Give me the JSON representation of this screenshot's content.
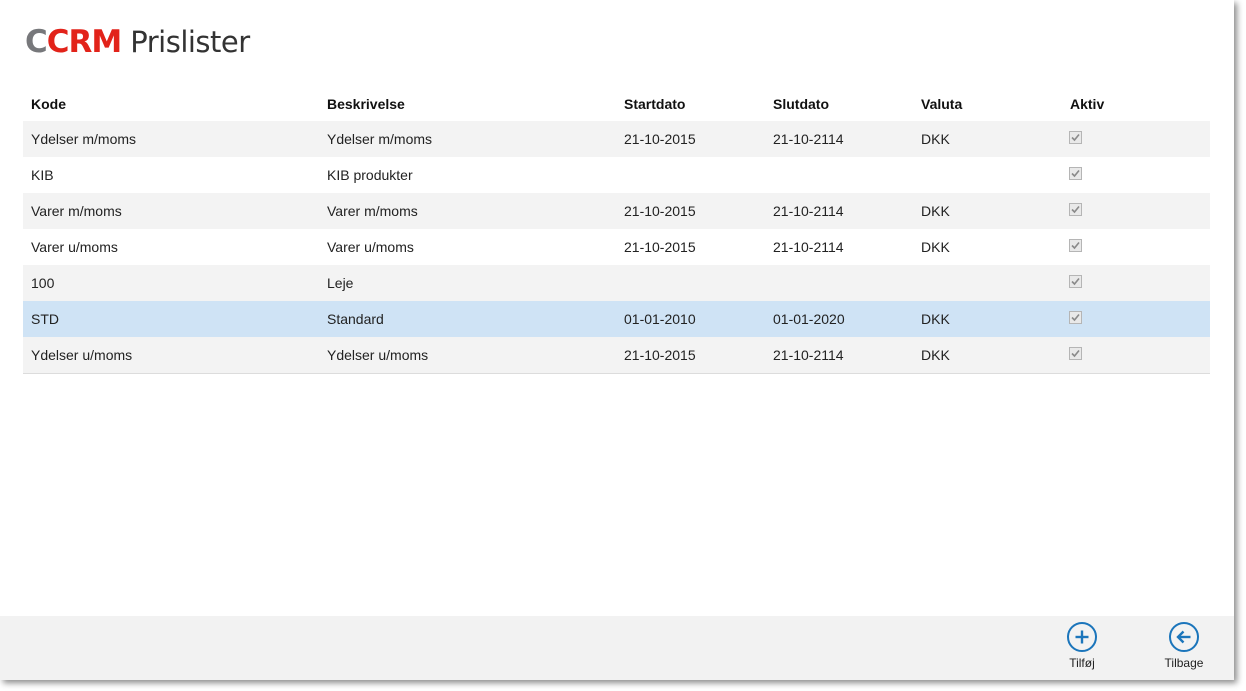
{
  "header": {
    "logo_c": "C",
    "logo_crm": "CRM",
    "title": "Prislister",
    "logo_colors": {
      "c": "#77787b",
      "crm": "#e2231a"
    }
  },
  "table": {
    "columns": [
      "Kode",
      "Beskrivelse",
      "Startdato",
      "Slutdato",
      "Valuta",
      "Aktiv"
    ],
    "rows": [
      {
        "kode": "Ydelser m/moms",
        "beskrivelse": "Ydelser m/moms",
        "startdato": "21-10-2015",
        "slutdato": "21-10-2114",
        "valuta": "DKK",
        "aktiv": true
      },
      {
        "kode": "KIB",
        "beskrivelse": "KIB produkter",
        "startdato": "",
        "slutdato": "",
        "valuta": "",
        "aktiv": true
      },
      {
        "kode": "Varer m/moms",
        "beskrivelse": "Varer m/moms",
        "startdato": "21-10-2015",
        "slutdato": "21-10-2114",
        "valuta": "DKK",
        "aktiv": true
      },
      {
        "kode": "Varer u/moms",
        "beskrivelse": "Varer u/moms",
        "startdato": "21-10-2015",
        "slutdato": "21-10-2114",
        "valuta": "DKK",
        "aktiv": true
      },
      {
        "kode": "100",
        "beskrivelse": "Leje",
        "startdato": "",
        "slutdato": "",
        "valuta": "",
        "aktiv": true
      },
      {
        "kode": "STD",
        "beskrivelse": "Standard",
        "startdato": "01-01-2010",
        "slutdato": "01-01-2020",
        "valuta": "DKK",
        "aktiv": true
      },
      {
        "kode": "Ydelser u/moms",
        "beskrivelse": "Ydelser u/moms",
        "startdato": "21-10-2015",
        "slutdato": "21-10-2114",
        "valuta": "DKK",
        "aktiv": true
      }
    ],
    "selected_row": 5,
    "selection_color": "#cfe3f5"
  },
  "appbar": {
    "add": {
      "label": "Tilføj",
      "icon": "plus-circle-icon"
    },
    "back": {
      "label": "Tilbage",
      "icon": "back-arrow-circle-icon"
    },
    "accent": "#1b75bb"
  }
}
